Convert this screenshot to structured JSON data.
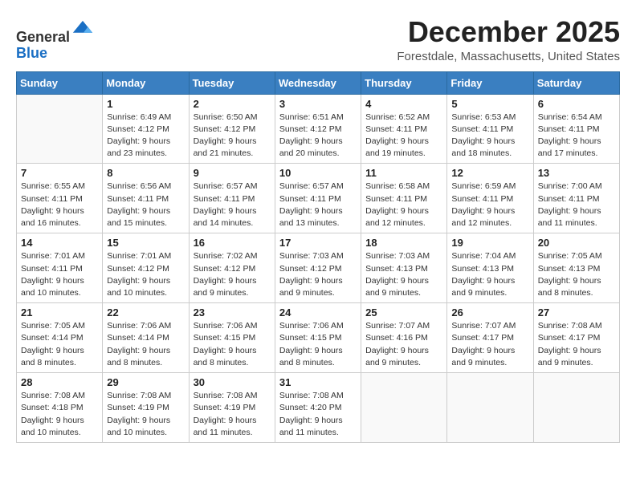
{
  "header": {
    "logo_general": "General",
    "logo_blue": "Blue",
    "month_year": "December 2025",
    "location": "Forestdale, Massachusetts, United States"
  },
  "days_of_week": [
    "Sunday",
    "Monday",
    "Tuesday",
    "Wednesday",
    "Thursday",
    "Friday",
    "Saturday"
  ],
  "weeks": [
    [
      {
        "day": "",
        "info": ""
      },
      {
        "day": "1",
        "info": "Sunrise: 6:49 AM\nSunset: 4:12 PM\nDaylight: 9 hours\nand 23 minutes."
      },
      {
        "day": "2",
        "info": "Sunrise: 6:50 AM\nSunset: 4:12 PM\nDaylight: 9 hours\nand 21 minutes."
      },
      {
        "day": "3",
        "info": "Sunrise: 6:51 AM\nSunset: 4:12 PM\nDaylight: 9 hours\nand 20 minutes."
      },
      {
        "day": "4",
        "info": "Sunrise: 6:52 AM\nSunset: 4:11 PM\nDaylight: 9 hours\nand 19 minutes."
      },
      {
        "day": "5",
        "info": "Sunrise: 6:53 AM\nSunset: 4:11 PM\nDaylight: 9 hours\nand 18 minutes."
      },
      {
        "day": "6",
        "info": "Sunrise: 6:54 AM\nSunset: 4:11 PM\nDaylight: 9 hours\nand 17 minutes."
      }
    ],
    [
      {
        "day": "7",
        "info": "Sunrise: 6:55 AM\nSunset: 4:11 PM\nDaylight: 9 hours\nand 16 minutes."
      },
      {
        "day": "8",
        "info": "Sunrise: 6:56 AM\nSunset: 4:11 PM\nDaylight: 9 hours\nand 15 minutes."
      },
      {
        "day": "9",
        "info": "Sunrise: 6:57 AM\nSunset: 4:11 PM\nDaylight: 9 hours\nand 14 minutes."
      },
      {
        "day": "10",
        "info": "Sunrise: 6:57 AM\nSunset: 4:11 PM\nDaylight: 9 hours\nand 13 minutes."
      },
      {
        "day": "11",
        "info": "Sunrise: 6:58 AM\nSunset: 4:11 PM\nDaylight: 9 hours\nand 12 minutes."
      },
      {
        "day": "12",
        "info": "Sunrise: 6:59 AM\nSunset: 4:11 PM\nDaylight: 9 hours\nand 12 minutes."
      },
      {
        "day": "13",
        "info": "Sunrise: 7:00 AM\nSunset: 4:11 PM\nDaylight: 9 hours\nand 11 minutes."
      }
    ],
    [
      {
        "day": "14",
        "info": "Sunrise: 7:01 AM\nSunset: 4:11 PM\nDaylight: 9 hours\nand 10 minutes."
      },
      {
        "day": "15",
        "info": "Sunrise: 7:01 AM\nSunset: 4:12 PM\nDaylight: 9 hours\nand 10 minutes."
      },
      {
        "day": "16",
        "info": "Sunrise: 7:02 AM\nSunset: 4:12 PM\nDaylight: 9 hours\nand 9 minutes."
      },
      {
        "day": "17",
        "info": "Sunrise: 7:03 AM\nSunset: 4:12 PM\nDaylight: 9 hours\nand 9 minutes."
      },
      {
        "day": "18",
        "info": "Sunrise: 7:03 AM\nSunset: 4:13 PM\nDaylight: 9 hours\nand 9 minutes."
      },
      {
        "day": "19",
        "info": "Sunrise: 7:04 AM\nSunset: 4:13 PM\nDaylight: 9 hours\nand 9 minutes."
      },
      {
        "day": "20",
        "info": "Sunrise: 7:05 AM\nSunset: 4:13 PM\nDaylight: 9 hours\nand 8 minutes."
      }
    ],
    [
      {
        "day": "21",
        "info": "Sunrise: 7:05 AM\nSunset: 4:14 PM\nDaylight: 9 hours\nand 8 minutes."
      },
      {
        "day": "22",
        "info": "Sunrise: 7:06 AM\nSunset: 4:14 PM\nDaylight: 9 hours\nand 8 minutes."
      },
      {
        "day": "23",
        "info": "Sunrise: 7:06 AM\nSunset: 4:15 PM\nDaylight: 9 hours\nand 8 minutes."
      },
      {
        "day": "24",
        "info": "Sunrise: 7:06 AM\nSunset: 4:15 PM\nDaylight: 9 hours\nand 8 minutes."
      },
      {
        "day": "25",
        "info": "Sunrise: 7:07 AM\nSunset: 4:16 PM\nDaylight: 9 hours\nand 9 minutes."
      },
      {
        "day": "26",
        "info": "Sunrise: 7:07 AM\nSunset: 4:17 PM\nDaylight: 9 hours\nand 9 minutes."
      },
      {
        "day": "27",
        "info": "Sunrise: 7:08 AM\nSunset: 4:17 PM\nDaylight: 9 hours\nand 9 minutes."
      }
    ],
    [
      {
        "day": "28",
        "info": "Sunrise: 7:08 AM\nSunset: 4:18 PM\nDaylight: 9 hours\nand 10 minutes."
      },
      {
        "day": "29",
        "info": "Sunrise: 7:08 AM\nSunset: 4:19 PM\nDaylight: 9 hours\nand 10 minutes."
      },
      {
        "day": "30",
        "info": "Sunrise: 7:08 AM\nSunset: 4:19 PM\nDaylight: 9 hours\nand 11 minutes."
      },
      {
        "day": "31",
        "info": "Sunrise: 7:08 AM\nSunset: 4:20 PM\nDaylight: 9 hours\nand 11 minutes."
      },
      {
        "day": "",
        "info": ""
      },
      {
        "day": "",
        "info": ""
      },
      {
        "day": "",
        "info": ""
      }
    ]
  ]
}
